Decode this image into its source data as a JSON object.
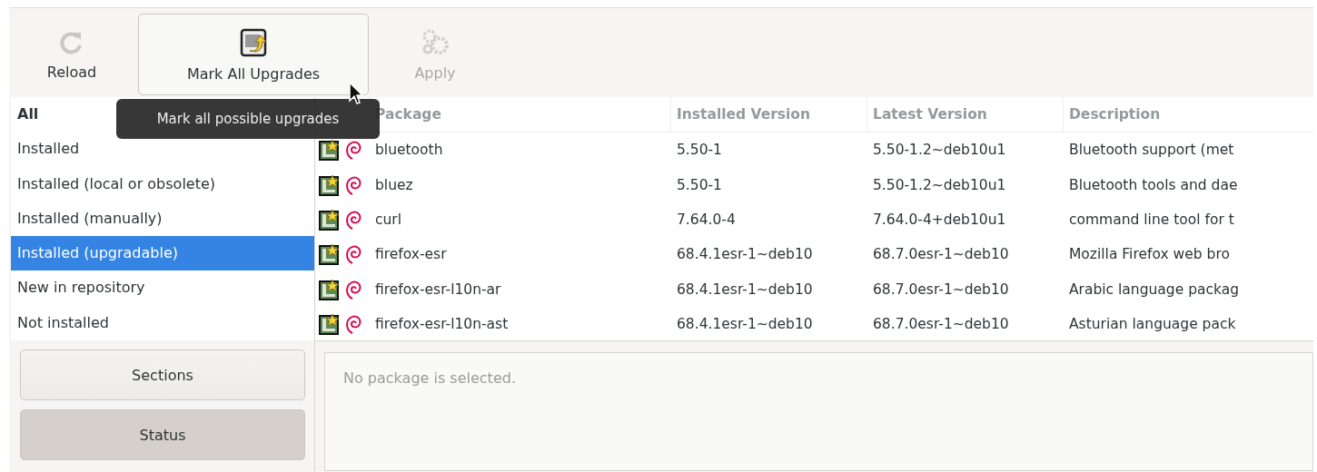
{
  "toolbar": [
    {
      "label": "Reload",
      "kind": "reload",
      "hovered": false,
      "disabled": false
    },
    {
      "label": "Mark All Upgrades",
      "kind": "upgrade",
      "hovered": true,
      "disabled": false
    },
    {
      "label": "Apply",
      "kind": "apply",
      "hovered": false,
      "disabled": true
    }
  ],
  "tooltip": "Mark all possible upgrades",
  "filters": [
    {
      "label": "All",
      "bold": true,
      "selected": false
    },
    {
      "label": "Installed",
      "bold": false,
      "selected": false
    },
    {
      "label": "Installed (local or obsolete)",
      "bold": false,
      "selected": false
    },
    {
      "label": "Installed (manually)",
      "bold": false,
      "selected": false
    },
    {
      "label": "Installed (upgradable)",
      "bold": false,
      "selected": true
    },
    {
      "label": "New in repository",
      "bold": false,
      "selected": false
    },
    {
      "label": "Not installed",
      "bold": false,
      "selected": false
    }
  ],
  "view_buttons": [
    {
      "label": "Sections",
      "selected": false
    },
    {
      "label": "Status",
      "selected": true
    }
  ],
  "table": {
    "columns": [
      "Package",
      "Installed Version",
      "Latest Version",
      "Description"
    ],
    "rows": [
      {
        "package": "bluetooth",
        "installed": "5.50-1",
        "latest": "5.50-1.2~deb10u1",
        "description": "Bluetooth support (met"
      },
      {
        "package": "bluez",
        "installed": "5.50-1",
        "latest": "5.50-1.2~deb10u1",
        "description": "Bluetooth tools and dae"
      },
      {
        "package": "curl",
        "installed": "7.64.0-4",
        "latest": "7.64.0-4+deb10u1",
        "description": "command line tool for t"
      },
      {
        "package": "firefox-esr",
        "installed": "68.4.1esr-1~deb10",
        "latest": "68.7.0esr-1~deb10",
        "description": "Mozilla Firefox web bro"
      },
      {
        "package": "firefox-esr-l10n-ar",
        "installed": "68.4.1esr-1~deb10",
        "latest": "68.7.0esr-1~deb10",
        "description": "Arabic language packag"
      },
      {
        "package": "firefox-esr-l10n-ast",
        "installed": "68.4.1esr-1~deb10",
        "latest": "68.7.0esr-1~deb10",
        "description": "Asturian language pack"
      }
    ]
  },
  "details": {
    "placeholder": "No package is selected."
  }
}
